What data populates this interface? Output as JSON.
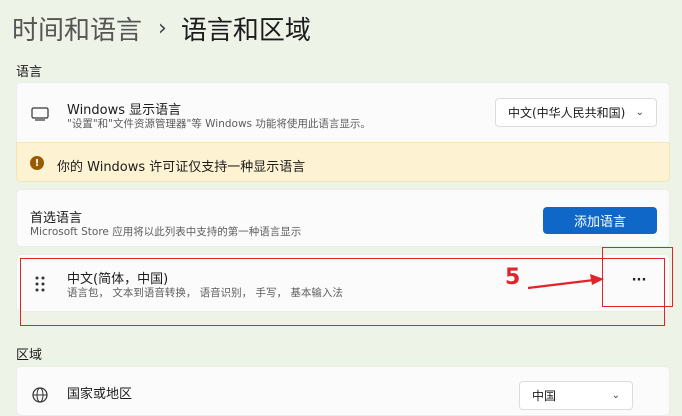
{
  "breadcrumb": {
    "parent": "时间和语言",
    "separator": "›",
    "current": "语言和区域"
  },
  "language_section": {
    "label": "语言",
    "windows_display": {
      "title": "Windows 显示语言",
      "subtitle": "\"设置\"和\"文件资源管理器\"等 Windows 功能将使用此语言显示。",
      "dropdown_value": "中文(中华人民共和国)",
      "icon": "monitor-icon"
    },
    "license_notice": {
      "text": "你的 Windows 许可证仅支持一种显示语言",
      "icon": "info-icon"
    },
    "preferred": {
      "title": "首选语言",
      "subtitle": "Microsoft Store 应用将以此列表中支持的第一种语言显示",
      "add_button": "添加语言"
    },
    "language_item": {
      "title": "中文(简体，中国)",
      "subtitle": "语言包， 文本到语音转换， 语音识别， 手写， 基本输入法",
      "more_label": "···"
    }
  },
  "region_section": {
    "label": "区域",
    "country": {
      "title": "国家或地区",
      "dropdown_value": "中国",
      "icon": "globe-icon"
    }
  },
  "annotation": {
    "step_number": "5"
  },
  "colors": {
    "accent": "#0f68c8",
    "annotation_red": "#e0242a",
    "warning_bg": "#fdf3d3"
  }
}
